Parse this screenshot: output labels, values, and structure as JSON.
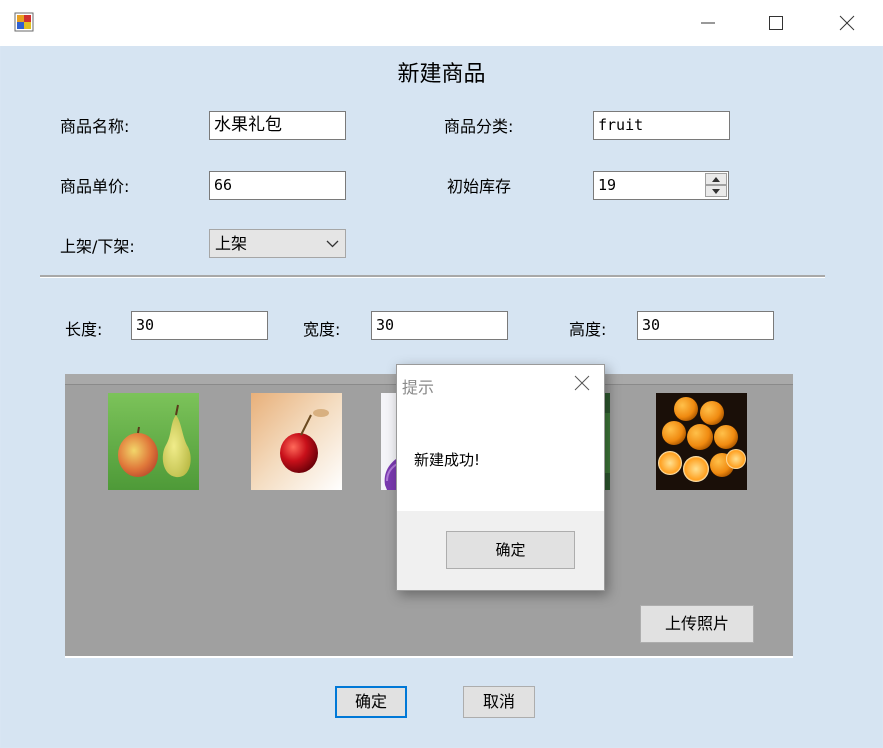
{
  "window": {
    "title": "",
    "minimize": "─",
    "maximize": "☐",
    "close": "✕"
  },
  "form": {
    "title": "新建商品",
    "name_label": "商品名称:",
    "name_value": "水果礼包",
    "category_label": "商品分类:",
    "category_value": "fruit",
    "price_label": "商品单价:",
    "price_value": "66",
    "stock_label": "初始库存",
    "stock_value": "19",
    "shelf_label": "上架/下架:",
    "shelf_value": "上架",
    "length_label": "长度:",
    "length_value": "30",
    "width_label": "宽度:",
    "width_value": "30",
    "height_label": "高度:",
    "height_value": "30",
    "upload_label": "上传照片",
    "confirm_label": "确定",
    "cancel_label": "取消"
  },
  "thumbnails": [
    "pear-apple-photo",
    "red-apple-photo",
    "purple-fruit-photo",
    "green-fruit-photo",
    "oranges-photo"
  ],
  "dialog": {
    "title": "提示",
    "message": "新建成功!",
    "ok_label": "确定"
  },
  "colors": {
    "client_bg": "#d6e4f2",
    "panel_bg": "#a0a0a0",
    "accent_border": "#0078d7"
  }
}
